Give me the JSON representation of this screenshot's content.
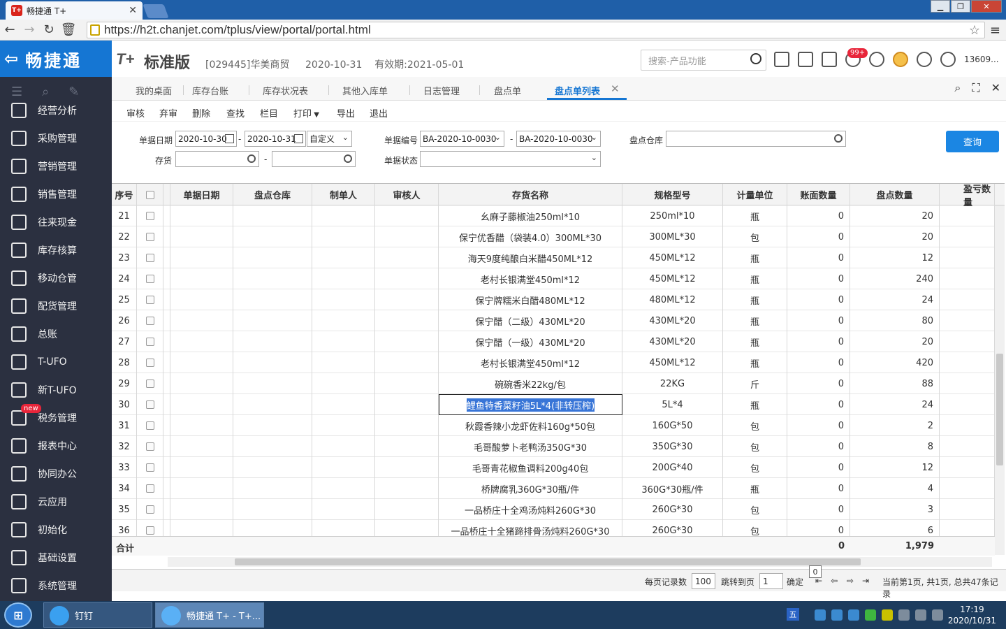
{
  "browser": {
    "tab_title": "畅捷通 T+",
    "url": "https://h2t.chanjet.com/tplus/view/portal/portal.html"
  },
  "sidebar": {
    "logo": "畅捷通",
    "items": [
      {
        "label": "经营分析",
        "icon": "analysis-icon"
      },
      {
        "label": "采购管理",
        "icon": "purchase-icon"
      },
      {
        "label": "营销管理",
        "icon": "marketing-icon"
      },
      {
        "label": "销售管理",
        "icon": "sales-icon"
      },
      {
        "label": "往来现金",
        "icon": "cash-icon"
      },
      {
        "label": "库存核算",
        "icon": "inventory-icon"
      },
      {
        "label": "移动仓管",
        "icon": "mobile-warehouse-icon"
      },
      {
        "label": "配货管理",
        "icon": "distribution-icon"
      },
      {
        "label": "总账",
        "icon": "ledger-icon"
      },
      {
        "label": "T-UFO",
        "icon": "ufo-icon"
      },
      {
        "label": "新T-UFO",
        "icon": "new-ufo-icon"
      },
      {
        "label": "税务管理",
        "icon": "tax-icon",
        "badge": "new"
      },
      {
        "label": "报表中心",
        "icon": "report-icon"
      },
      {
        "label": "协同办公",
        "icon": "collab-icon"
      },
      {
        "label": "云应用",
        "icon": "cloud-icon"
      },
      {
        "label": "初始化",
        "icon": "init-icon"
      },
      {
        "label": "基础设置",
        "icon": "settings-icon"
      },
      {
        "label": "系统管理",
        "icon": "system-icon"
      }
    ]
  },
  "header": {
    "brand_t": "T+",
    "brand_name": "标准版",
    "company": "[029445]华美商贸",
    "date": "2020-10-31",
    "valid_until": "有效期:2021-05-01",
    "search_placeholder": "搜索-产品功能",
    "notif_badge": "99+",
    "user": "13609..."
  },
  "tabs": [
    {
      "label": "我的桌面"
    },
    {
      "label": "库存台账"
    },
    {
      "label": "库存状况表"
    },
    {
      "label": "其他入库单"
    },
    {
      "label": "日志管理"
    },
    {
      "label": "盘点单"
    },
    {
      "label": "盘点单列表",
      "active": true
    }
  ],
  "toolbar": [
    "审核",
    "弃审",
    "删除",
    "查找",
    "栏目",
    "打印",
    "导出",
    "退出"
  ],
  "filters": {
    "date_label": "单据日期",
    "date_from": "2020-10-30",
    "date_to": "2020-10-31",
    "date_mode": "自定义",
    "code_label": "单据编号",
    "code_from": "BA-2020-10-0030",
    "code_to": "BA-2020-10-0030",
    "warehouse_label": "盘点仓库",
    "item_label": "存货",
    "status_label": "单据状态",
    "dash": "-",
    "query_button": "查询"
  },
  "grid": {
    "columns": [
      "序号",
      "",
      "单据日期",
      "盘点仓库",
      "制单人",
      "审核人",
      "存货名称",
      "规格型号",
      "计量单位",
      "账面数量",
      "盘点数量",
      "盈亏数量"
    ],
    "rows": [
      {
        "no": "21",
        "name": "幺麻子藤椒油250ml*10",
        "spec": "250ml*10",
        "unit": "瓶",
        "book": "0",
        "count": "20"
      },
      {
        "no": "22",
        "name": "保宁优香醋（袋装4.0）300ML*30",
        "spec": "300ML*30",
        "unit": "包",
        "book": "0",
        "count": "20"
      },
      {
        "no": "23",
        "name": "海天9度纯酿白米醋450ML*12",
        "spec": "450ML*12",
        "unit": "瓶",
        "book": "0",
        "count": "12"
      },
      {
        "no": "24",
        "name": "老村长银满堂450ml*12",
        "spec": "450ML*12",
        "unit": "瓶",
        "book": "0",
        "count": "240"
      },
      {
        "no": "25",
        "name": "保宁牌糯米白醋480ML*12",
        "spec": "480ML*12",
        "unit": "瓶",
        "book": "0",
        "count": "24"
      },
      {
        "no": "26",
        "name": "保宁醋（二级）430ML*20",
        "spec": "430ML*20",
        "unit": "瓶",
        "book": "0",
        "count": "80"
      },
      {
        "no": "27",
        "name": "保宁醋（一级）430ML*20",
        "spec": "430ML*20",
        "unit": "瓶",
        "book": "0",
        "count": "20"
      },
      {
        "no": "28",
        "name": "老村长银满堂450ml*12",
        "spec": "450ML*12",
        "unit": "瓶",
        "book": "0",
        "count": "420"
      },
      {
        "no": "29",
        "name": "碗碗香米22kg/包",
        "spec": "22KG",
        "unit": "斤",
        "book": "0",
        "count": "88"
      },
      {
        "no": "30",
        "name": "鲤鱼特香菜籽油5L*4(非转压榨)",
        "spec": "5L*4",
        "unit": "瓶",
        "book": "0",
        "count": "24",
        "selected": true
      },
      {
        "no": "31",
        "name": "秋霞香辣小龙虾佐料160g*50包",
        "spec": "160G*50",
        "unit": "包",
        "book": "0",
        "count": "2"
      },
      {
        "no": "32",
        "name": "毛哥酸萝卜老鸭汤350G*30",
        "spec": "350G*30",
        "unit": "包",
        "book": "0",
        "count": "8"
      },
      {
        "no": "33",
        "name": "毛哥青花椒鱼调料200g40包",
        "spec": "200G*40",
        "unit": "包",
        "book": "0",
        "count": "12"
      },
      {
        "no": "34",
        "name": "桥牌腐乳360G*30瓶/件",
        "spec": "360G*30瓶/件",
        "unit": "瓶",
        "book": "0",
        "count": "4"
      },
      {
        "no": "35",
        "name": "一品桥庄十全鸡汤炖料260G*30",
        "spec": "260G*30",
        "unit": "包",
        "book": "0",
        "count": "3"
      },
      {
        "no": "36",
        "name": "一品桥庄十全猪蹄排骨汤炖料260G*30",
        "spec": "260G*30",
        "unit": "包",
        "book": "0",
        "count": "6"
      }
    ],
    "total_label": "合计",
    "total_book": "0",
    "total_count": "1,979"
  },
  "pager": {
    "per_page_label": "每页记录数",
    "per_page": "100",
    "jump_label": "跳转到页",
    "jump_page": "1",
    "confirm": "确定",
    "tooltip": "0",
    "summary": "当前第1页, 共1页, 总共47条记录"
  },
  "taskbar": {
    "items": [
      {
        "label": "钉钉"
      },
      {
        "label": "畅捷通 T+ - T+..."
      }
    ],
    "ime": "五",
    "time": "17:19",
    "date": "2020/10/31"
  }
}
